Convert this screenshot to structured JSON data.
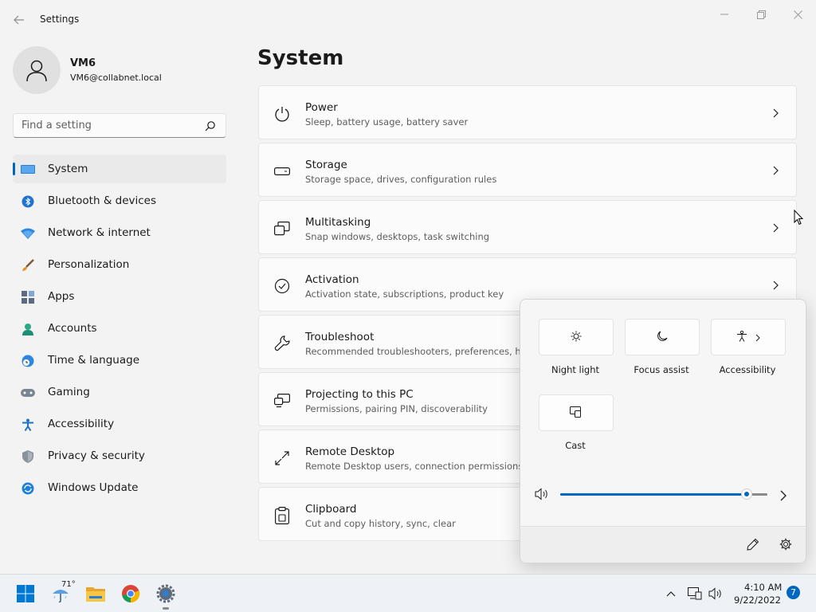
{
  "window": {
    "title": "Settings",
    "back_icon": "back-arrow-icon",
    "minimize_icon": "minimize-icon",
    "maximize_icon": "restore-icon",
    "close_icon": "close-icon"
  },
  "profile": {
    "name": "VM6",
    "email": "VM6@collabnet.local"
  },
  "search": {
    "placeholder": "Find a setting",
    "value": ""
  },
  "sidebar": {
    "items": [
      {
        "label": "System",
        "icon": "monitor-icon",
        "selected": true
      },
      {
        "label": "Bluetooth & devices",
        "icon": "bluetooth-icon"
      },
      {
        "label": "Network & internet",
        "icon": "wifi-icon"
      },
      {
        "label": "Personalization",
        "icon": "paintbrush-icon"
      },
      {
        "label": "Apps",
        "icon": "apps-icon"
      },
      {
        "label": "Accounts",
        "icon": "person-icon"
      },
      {
        "label": "Time & language",
        "icon": "globe-clock-icon"
      },
      {
        "label": "Gaming",
        "icon": "gamepad-icon"
      },
      {
        "label": "Accessibility",
        "icon": "accessibility-icon"
      },
      {
        "label": "Privacy & security",
        "icon": "shield-icon"
      },
      {
        "label": "Windows Update",
        "icon": "update-icon"
      }
    ]
  },
  "main": {
    "title": "System",
    "cards": [
      {
        "title": "Power",
        "desc": "Sleep, battery usage, battery saver",
        "icon": "power-icon"
      },
      {
        "title": "Storage",
        "desc": "Storage space, drives, configuration rules",
        "icon": "storage-icon"
      },
      {
        "title": "Multitasking",
        "desc": "Snap windows, desktops, task switching",
        "icon": "multitasking-icon"
      },
      {
        "title": "Activation",
        "desc": "Activation state, subscriptions, product key",
        "icon": "activation-check-icon"
      },
      {
        "title": "Troubleshoot",
        "desc": "Recommended troubleshooters, preferences, histo",
        "icon": "wrench-icon"
      },
      {
        "title": "Projecting to this PC",
        "desc": "Permissions, pairing PIN, discoverability",
        "icon": "projecting-icon"
      },
      {
        "title": "Remote Desktop",
        "desc": "Remote Desktop users, connection permissions",
        "icon": "remote-desktop-icon"
      },
      {
        "title": "Clipboard",
        "desc": "Cut and copy history, sync, clear",
        "icon": "clipboard-icon"
      }
    ]
  },
  "quick_settings": {
    "tiles": [
      {
        "label": "Night light",
        "icon": "brightness-icon"
      },
      {
        "label": "Focus assist",
        "icon": "moon-icon"
      },
      {
        "label": "Accessibility",
        "icon": "accessibility-icon"
      },
      {
        "label": "Cast",
        "icon": "cast-icon"
      }
    ],
    "volume_level": 0.9,
    "volume_icon": "speaker-icon",
    "edit_icon": "pencil-icon",
    "settings_icon": "gear-icon"
  },
  "taskbar": {
    "weather_temp": "71°",
    "time": "4:10 AM",
    "date": "9/22/2022",
    "notification_count": "7",
    "apps": [
      "start-icon",
      "weather-icon",
      "file-explorer-icon",
      "chrome-icon",
      "settings-gear-icon"
    ]
  },
  "colors": {
    "accent": "#0067c0",
    "background": "#f3f3f3"
  }
}
